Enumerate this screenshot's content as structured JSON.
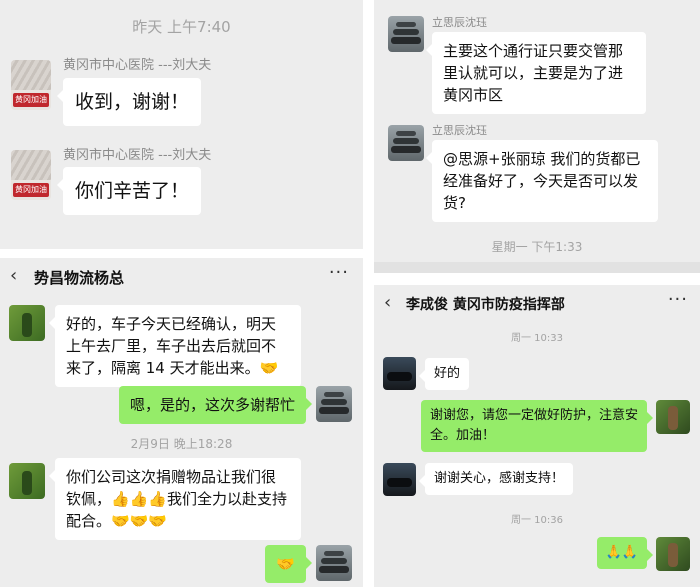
{
  "panel1": {
    "timestamp": "昨天 上午7:40",
    "messages": [
      {
        "sender": "黄冈市中心医院 ---刘大夫",
        "text": "收到，谢谢！"
      },
      {
        "sender": "黄冈市中心医院 ---刘大夫",
        "text": "你们辛苦了！"
      }
    ],
    "avatar_badge": "黄冈加油"
  },
  "panel2": {
    "messages": [
      {
        "sender": "立思辰沈珏",
        "text": "主要这个通行证只要交管那里认就可以，主要是为了进黄冈市区"
      },
      {
        "sender": "立思辰沈珏",
        "text": "@思源+张丽琼 我们的货都已经准备好了，今天是否可以发货?"
      }
    ],
    "timestamp": "星期一 下午1:33"
  },
  "panel3": {
    "title": "势昌物流杨总",
    "more": "···",
    "messages": [
      {
        "text": "好的，车子今天已经确认，明天上午去厂里，车子出去后就回不来了，隔离 14 天才能出来。🤝"
      },
      {
        "text": "嗯，是的，这次多谢帮忙"
      },
      {
        "text": "你们公司这次捐赠物品让我们很钦佩，👍👍👍我们全力以赴支持配合。🤝🤝🤝"
      },
      {
        "text": "🤝"
      }
    ],
    "timestamp": "2月9日 晚上18:28"
  },
  "panel4": {
    "title": "李成俊 黄冈市防疫指挥部",
    "more": "···",
    "timestamps": [
      "周一 10:33",
      "周一 10:36"
    ],
    "messages": [
      {
        "text": "好的"
      },
      {
        "text": "谢谢您，请您一定做好防护，注意安全。加油！"
      },
      {
        "text": "谢谢关心，感谢支持！"
      },
      {
        "text": "🙏🙏"
      }
    ]
  }
}
